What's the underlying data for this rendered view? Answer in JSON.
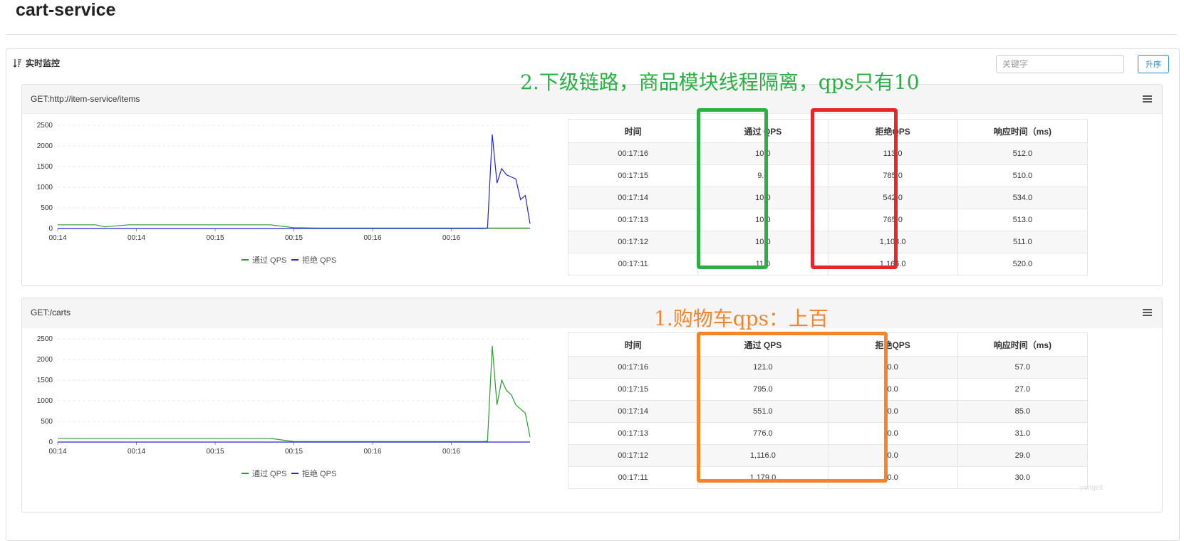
{
  "page": {
    "title": "cart-service"
  },
  "toolbar": {
    "monitor_label": "实时监控",
    "search_placeholder": "关键字",
    "sort_label": "升序"
  },
  "cards": [
    {
      "resource": "GET:http://item-service/items",
      "table": {
        "headers": [
          "时间",
          "通过 QPS",
          "拒绝QPS",
          "响应时间（ms)"
        ],
        "rows": [
          [
            "00:17:16",
            "10.0",
            "113.0",
            "512.0"
          ],
          [
            "00:17:15",
            "9.0",
            "785.0",
            "510.0"
          ],
          [
            "00:17:14",
            "10.0",
            "542.0",
            "534.0"
          ],
          [
            "00:17:13",
            "10.0",
            "765.0",
            "513.0"
          ],
          [
            "00:17:12",
            "10.0",
            "1,108.0",
            "511.0"
          ],
          [
            "00:17:11",
            "11.0",
            "1,166.0",
            "520.0"
          ]
        ]
      }
    },
    {
      "resource": "GET:/carts",
      "table": {
        "headers": [
          "时间",
          "通过 QPS",
          "拒绝QPS",
          "响应时间（ms)"
        ],
        "rows": [
          [
            "00:17:16",
            "121.0",
            "0.0",
            "57.0"
          ],
          [
            "00:17:15",
            "795.0",
            "0.0",
            "27.0"
          ],
          [
            "00:17:14",
            "551.0",
            "0.0",
            "85.0"
          ],
          [
            "00:17:13",
            "776.0",
            "0.0",
            "31.0"
          ],
          [
            "00:17:12",
            "1,116.0",
            "0.0",
            "29.0"
          ],
          [
            "00:17:11",
            "1,179.0",
            "0.0",
            "30.0"
          ]
        ]
      }
    }
  ],
  "chart_data": [
    {
      "type": "line",
      "ylim": [
        0,
        2500
      ],
      "yticks": [
        0,
        500,
        1000,
        1500,
        2000,
        2500
      ],
      "xtick_labels": [
        "00:14",
        "00:14",
        "00:15",
        "00:15",
        "00:16",
        "00:16"
      ],
      "x": [
        0,
        2,
        5,
        8,
        10,
        15,
        20,
        25,
        30,
        35,
        40,
        45,
        50,
        55,
        60,
        65,
        70,
        75,
        80,
        85,
        90,
        91,
        92,
        93,
        94,
        95,
        96,
        97,
        98,
        99,
        100
      ],
      "series": [
        {
          "name": "通过 QPS",
          "color": "#2a9d2a",
          "values": [
            90,
            90,
            90,
            90,
            40,
            90,
            90,
            90,
            90,
            90,
            90,
            90,
            20,
            10,
            10,
            10,
            10,
            10,
            10,
            10,
            10,
            10,
            10,
            10,
            10,
            10,
            10,
            10,
            10,
            10,
            11
          ]
        },
        {
          "name": "拒绝 QPS",
          "color": "#2323d8",
          "values": [
            0,
            0,
            0,
            0,
            0,
            0,
            0,
            0,
            0,
            0,
            0,
            0,
            0,
            0,
            0,
            0,
            0,
            0,
            0,
            0,
            0,
            10,
            2280,
            1100,
            1450,
            1300,
            1250,
            1200,
            700,
            800,
            113
          ]
        }
      ]
    },
    {
      "type": "line",
      "ylim": [
        0,
        2500
      ],
      "yticks": [
        0,
        500,
        1000,
        1500,
        2000,
        2500
      ],
      "xtick_labels": [
        "00:14",
        "00:14",
        "00:15",
        "00:15",
        "00:16",
        "00:16"
      ],
      "x": [
        0,
        2,
        5,
        8,
        10,
        15,
        20,
        25,
        30,
        35,
        40,
        45,
        50,
        55,
        60,
        65,
        70,
        75,
        80,
        85,
        90,
        91,
        92,
        93,
        94,
        95,
        96,
        97,
        98,
        99,
        100
      ],
      "series": [
        {
          "name": "通过 QPS",
          "color": "#2a9d2a",
          "values": [
            90,
            90,
            90,
            90,
            90,
            90,
            90,
            90,
            90,
            90,
            90,
            90,
            10,
            10,
            10,
            10,
            10,
            10,
            10,
            10,
            10,
            20,
            2330,
            900,
            1500,
            1250,
            1150,
            900,
            800,
            700,
            121
          ]
        },
        {
          "name": "拒绝 QPS",
          "color": "#2323d8",
          "values": [
            0,
            0,
            0,
            0,
            0,
            0,
            0,
            0,
            0,
            0,
            0,
            0,
            0,
            0,
            0,
            0,
            0,
            0,
            0,
            0,
            0,
            0,
            0,
            0,
            0,
            0,
            0,
            0,
            0,
            0,
            0
          ]
        }
      ]
    }
  ],
  "annotations": {
    "green_red_text": "2.下级链路，商品模块线程隔离，qps只有10",
    "orange_text": "1.购物车qps：上百",
    "colors": {
      "green": "#2ab042",
      "red": "#e8262a",
      "orange": "#f5842a"
    }
  },
  "watermark": "yangeit"
}
